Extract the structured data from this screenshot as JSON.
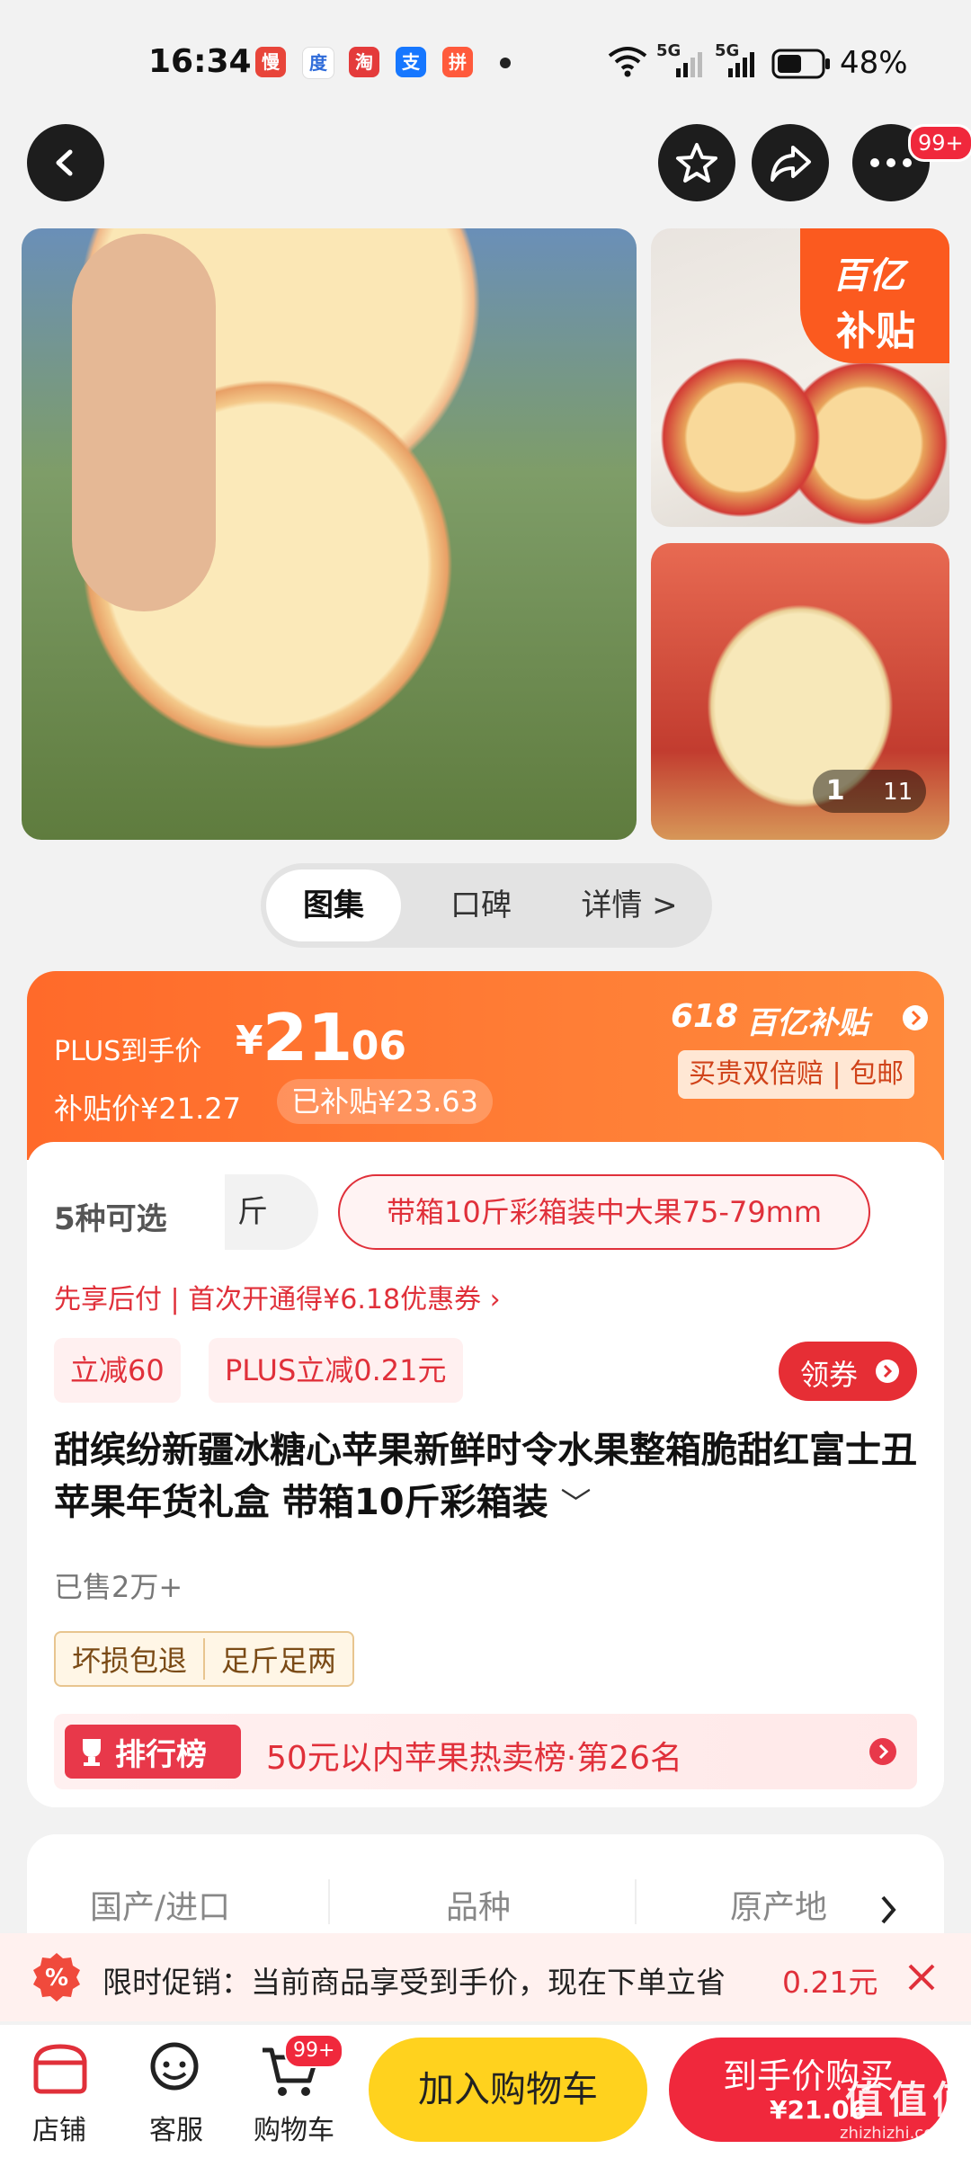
{
  "status_bar": {
    "time": "16:34",
    "battery": "48%",
    "signal1": "5G",
    "signal2": "5G"
  },
  "nav": {
    "more_badge": "99+"
  },
  "gallery": {
    "subsidy_badge_line1": "百亿",
    "subsidy_badge_line2": "补贴",
    "counter_current": "1",
    "counter_total": "11"
  },
  "tabs": [
    "图集",
    "口碑",
    "详情 >"
  ],
  "price": {
    "plus_label": "PLUS到手价",
    "currency": "¥",
    "main_int": "21",
    "main_dec": ".06",
    "subsidy_price": "补贴价¥21.27",
    "subsidized": "已补贴¥23.63",
    "promo_618": "618",
    "promo_brand": "百亿补贴",
    "guarantee": "买贵双倍赔 | 包邮"
  },
  "spec": {
    "count": "5种可选",
    "partial": "斤",
    "selected": "带箱10斤彩箱装中大果75-79mm"
  },
  "pay_later": "先享后付 | 首次开通得¥6.18优惠券 ›",
  "coupons": [
    "立减60",
    "PLUS立减0.21元"
  ],
  "claim_coupon": "领券",
  "title": "甜缤纷新疆冰糖心苹果新鲜时令水果整箱脆甜红富士丑苹果年货礼盒 带箱10斤彩箱装",
  "sold": "已售2万+",
  "tags": [
    "坏损包退",
    "足斤足两"
  ],
  "rank": {
    "label": "排行榜",
    "text": "50元以内苹果热卖榜·第26名"
  },
  "attrs": [
    "国产/进口",
    "品种",
    "原产地"
  ],
  "promo_bar": {
    "text": "限时促销：当前商品享受到手价，现在下单立省",
    "amount": "0.21元"
  },
  "bottom": {
    "shop": "店铺",
    "service": "客服",
    "cart": "购物车",
    "cart_badge": "99+",
    "add_cart": "加入购物车",
    "buy": "到手价购买",
    "buy_price": "¥21.06"
  },
  "watermark": "值 值 值",
  "watermark_url": "zhizhizhi.com",
  "colors": {
    "accent": "#f0283c",
    "orange": "#ff6a2a",
    "yellow": "#ffd21e"
  }
}
